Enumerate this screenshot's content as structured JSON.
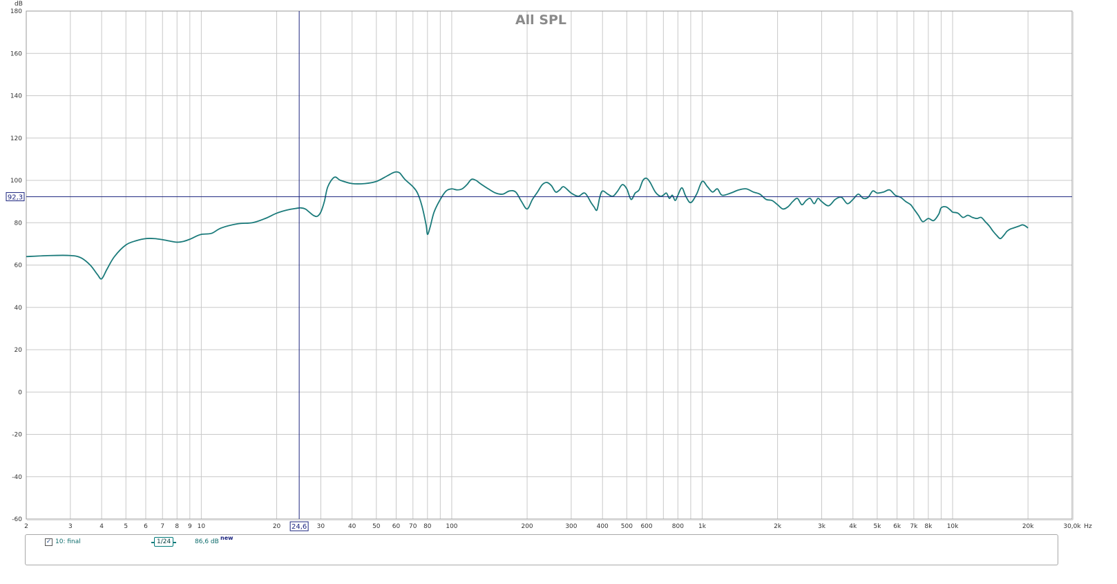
{
  "chart_data": {
    "type": "line",
    "title": "All SPL",
    "ylabel": "dB",
    "xlabel": "Hz",
    "x_scale": "log",
    "xlim": [
      2,
      30000
    ],
    "ylim": [
      -60,
      180
    ],
    "grid": true,
    "y_ticks": [
      -60,
      -40,
      -20,
      0,
      20,
      40,
      60,
      80,
      100,
      120,
      140,
      160,
      180
    ],
    "x_ticks": [
      {
        "value": 2,
        "label": "2"
      },
      {
        "value": 3,
        "label": "3"
      },
      {
        "value": 4,
        "label": "4"
      },
      {
        "value": 5,
        "label": "5"
      },
      {
        "value": 6,
        "label": "6"
      },
      {
        "value": 7,
        "label": "7"
      },
      {
        "value": 8,
        "label": "8"
      },
      {
        "value": 9,
        "label": "9"
      },
      {
        "value": 10,
        "label": "10"
      },
      {
        "value": 20,
        "label": "20"
      },
      {
        "value": 30,
        "label": "30"
      },
      {
        "value": 40,
        "label": "40"
      },
      {
        "value": 50,
        "label": "50"
      },
      {
        "value": 60,
        "label": "60"
      },
      {
        "value": 70,
        "label": "70"
      },
      {
        "value": 80,
        "label": "80"
      },
      {
        "value": 100,
        "label": "100"
      },
      {
        "value": 200,
        "label": "200"
      },
      {
        "value": 300,
        "label": "300"
      },
      {
        "value": 400,
        "label": "400"
      },
      {
        "value": 500,
        "label": "500"
      },
      {
        "value": 600,
        "label": "600"
      },
      {
        "value": 800,
        "label": "800"
      },
      {
        "value": 1000,
        "label": "1k"
      },
      {
        "value": 2000,
        "label": "2k"
      },
      {
        "value": 3000,
        "label": "3k"
      },
      {
        "value": 4000,
        "label": "4k"
      },
      {
        "value": 5000,
        "label": "5k"
      },
      {
        "value": 6000,
        "label": "6k"
      },
      {
        "value": 7000,
        "label": "7k"
      },
      {
        "value": 8000,
        "label": "8k"
      },
      {
        "value": 10000,
        "label": "10k"
      },
      {
        "value": 20000,
        "label": "20k"
      },
      {
        "value": 30000,
        "label": "30,0k"
      }
    ],
    "cursor": {
      "x": 24.6,
      "x_label": "24,6",
      "y": 92.3,
      "y_label": "92,3"
    },
    "colors": {
      "series": "#1a7a7a",
      "cursor": "#1a237e",
      "grid": "#c8c8c8",
      "title": "#8a8a8a"
    },
    "series": [
      {
        "name": "10: final",
        "color": "#1a7a7a",
        "x": [
          2,
          2.5,
          3,
          3.3,
          3.6,
          3.85,
          4.0,
          4.2,
          4.5,
          5.0,
          5.5,
          6.0,
          6.5,
          7.0,
          7.5,
          8.0,
          8.5,
          9.0,
          9.5,
          10,
          11,
          12,
          14,
          16,
          18,
          20,
          22,
          24,
          25,
          26,
          27,
          28,
          29,
          30,
          31,
          32,
          34,
          36,
          40,
          45,
          50,
          55,
          58,
          60,
          62,
          65,
          70,
          73,
          76,
          79,
          80,
          82,
          85,
          90,
          95,
          100,
          105,
          110,
          115,
          120,
          125,
          130,
          140,
          150,
          160,
          170,
          180,
          190,
          200,
          210,
          220,
          230,
          240,
          250,
          260,
          270,
          280,
          300,
          320,
          340,
          360,
          370,
          380,
          390,
          400,
          420,
          440,
          460,
          480,
          500,
          520,
          540,
          560,
          580,
          600,
          620,
          650,
          680,
          700,
          720,
          740,
          760,
          780,
          800,
          830,
          860,
          900,
          950,
          1000,
          1050,
          1100,
          1150,
          1200,
          1300,
          1400,
          1500,
          1600,
          1700,
          1800,
          1900,
          2000,
          2100,
          2200,
          2300,
          2400,
          2500,
          2600,
          2700,
          2800,
          2900,
          3000,
          3200,
          3400,
          3600,
          3800,
          4000,
          4200,
          4400,
          4600,
          4800,
          5000,
          5300,
          5600,
          5900,
          6200,
          6500,
          6800,
          7000,
          7300,
          7600,
          8000,
          8400,
          8800,
          9000,
          9400,
          9800,
          10000,
          10500,
          11000,
          11500,
          12000,
          12500,
          13000,
          13500,
          14000,
          14500,
          15000,
          15500,
          16000,
          16500,
          17000,
          17500,
          18000,
          18500,
          19000,
          19500,
          20000
        ],
        "values": [
          64,
          64.5,
          64.5,
          63.5,
          60,
          55.5,
          53.5,
          58,
          64,
          69.5,
          71.5,
          72.5,
          72.5,
          72,
          71.3,
          70.8,
          71.2,
          72.2,
          73.5,
          74.5,
          75,
          77.5,
          79.5,
          80,
          82,
          84.5,
          86,
          86.8,
          87,
          86.5,
          85,
          83.5,
          83,
          85,
          90,
          97,
          101.5,
          100,
          98.5,
          98.5,
          99.5,
          102,
          103.5,
          104,
          103.5,
          100.5,
          97,
          94,
          88,
          79,
          74.5,
          78,
          85,
          91,
          95,
          96,
          95.5,
          96,
          98,
          100.5,
          100,
          98.5,
          96,
          94,
          93.5,
          95,
          94.5,
          90,
          86.5,
          91,
          94.5,
          98,
          99,
          97.5,
          94.5,
          95.5,
          97,
          94,
          92.5,
          94,
          89.5,
          87.5,
          86,
          92,
          95,
          93.5,
          92.5,
          95,
          98,
          96,
          91,
          94,
          95.5,
          100,
          101,
          99,
          94.5,
          92.5,
          93,
          94,
          91.5,
          93,
          90.5,
          93,
          96.5,
          92.5,
          89.5,
          93.5,
          99.5,
          97,
          94.5,
          96,
          93,
          94,
          95.5,
          96,
          94.5,
          93.5,
          91,
          90.5,
          88.5,
          86.5,
          87.5,
          90,
          91.5,
          88.5,
          90.5,
          91.5,
          89,
          91.5,
          90,
          88,
          91,
          92,
          89,
          91,
          93.5,
          91.5,
          92,
          95,
          94,
          94.5,
          95.5,
          93,
          92,
          90,
          88.5,
          86.5,
          83.5,
          80.5,
          82,
          81,
          84,
          87,
          87.5,
          86,
          85,
          84.5,
          82.5,
          83.5,
          82.5,
          82,
          82.5,
          80.5,
          78.5,
          76,
          74,
          72.5,
          74,
          76,
          77,
          77.5,
          78,
          78.5,
          79,
          78.5,
          77.5
        ]
      }
    ]
  },
  "legend": {
    "items": [
      {
        "checked_glyph": "✓",
        "name": "10: final",
        "smoothing": "1/24",
        "value": "86,6 dB",
        "badge": "new"
      }
    ]
  }
}
